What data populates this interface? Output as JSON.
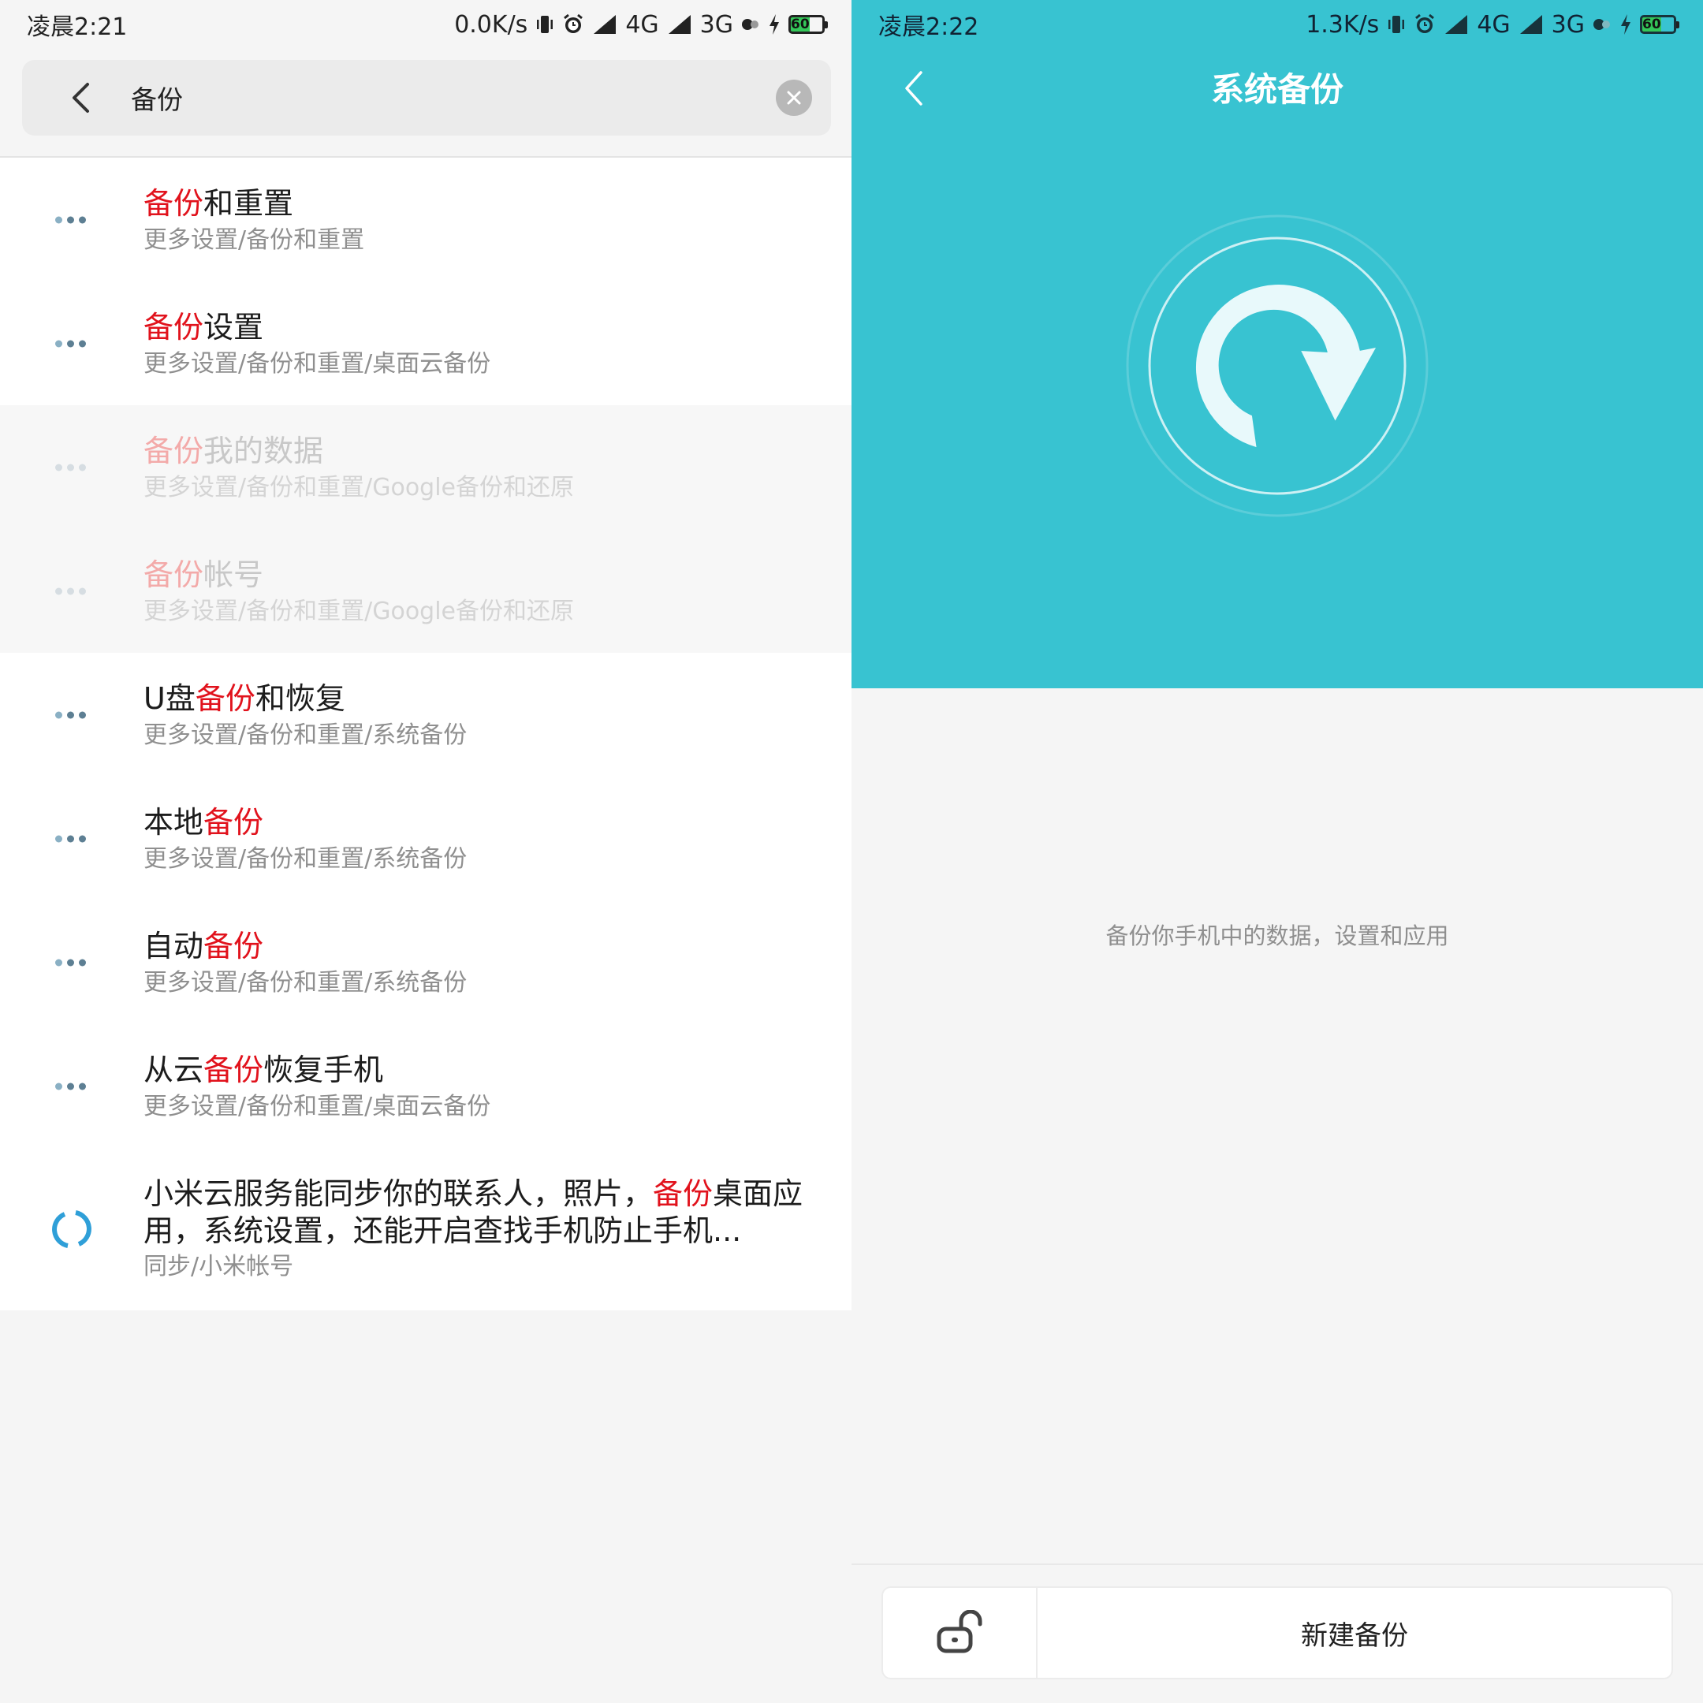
{
  "left": {
    "status": {
      "time": "凌晨2:21",
      "speed": "0.0K/s",
      "net1": "4G",
      "net2": "3G",
      "battery": "60"
    },
    "search": {
      "value": "备份",
      "placeholder": ""
    },
    "results": [
      {
        "title_parts": [
          "",
          "备份",
          "和重置"
        ],
        "path": "更多设置/备份和重置",
        "dim": false,
        "icon": "dots-icon"
      },
      {
        "title_parts": [
          "",
          "备份",
          "设置"
        ],
        "path": "更多设置/备份和重置/桌面云备份",
        "dim": false,
        "icon": "dots-icon"
      },
      {
        "title_parts": [
          "",
          "备份",
          "我的数据"
        ],
        "path": "更多设置/备份和重置/Google备份和还原",
        "dim": true,
        "icon": "dots-icon"
      },
      {
        "title_parts": [
          "",
          "备份",
          "帐号"
        ],
        "path": "更多设置/备份和重置/Google备份和还原",
        "dim": true,
        "icon": "dots-icon"
      },
      {
        "title_parts": [
          "U盘",
          "备份",
          "和恢复"
        ],
        "path": "更多设置/备份和重置/系统备份",
        "dim": false,
        "icon": "dots-icon"
      },
      {
        "title_parts": [
          "本地",
          "备份",
          ""
        ],
        "path": "更多设置/备份和重置/系统备份",
        "dim": false,
        "icon": "dots-icon"
      },
      {
        "title_parts": [
          "自动",
          "备份",
          ""
        ],
        "path": "更多设置/备份和重置/系统备份",
        "dim": false,
        "icon": "dots-icon"
      },
      {
        "title_parts": [
          "从云",
          "备份",
          "恢复手机"
        ],
        "path": "更多设置/备份和重置/桌面云备份",
        "dim": false,
        "icon": "dots-icon"
      },
      {
        "title_parts": [
          "小米云服务能同步你的联系人，照片，",
          "备份",
          "桌面应用，系统设置，还能开启查找手机防止手机..."
        ],
        "path": "同步/小米帐号",
        "dim": false,
        "icon": "mi-cloud-icon"
      }
    ]
  },
  "right": {
    "status": {
      "time": "凌晨2:22",
      "speed": "1.3K/s",
      "net1": "4G",
      "net2": "3G",
      "battery": "60"
    },
    "title": "系统备份",
    "description": "备份你手机中的数据，设置和应用",
    "new_backup_label": "新建备份",
    "lock_icon": "unlock-icon"
  },
  "colors": {
    "accent": "#38c3d1",
    "highlight": "#e1121c",
    "subtext": "#8f8f8f"
  }
}
